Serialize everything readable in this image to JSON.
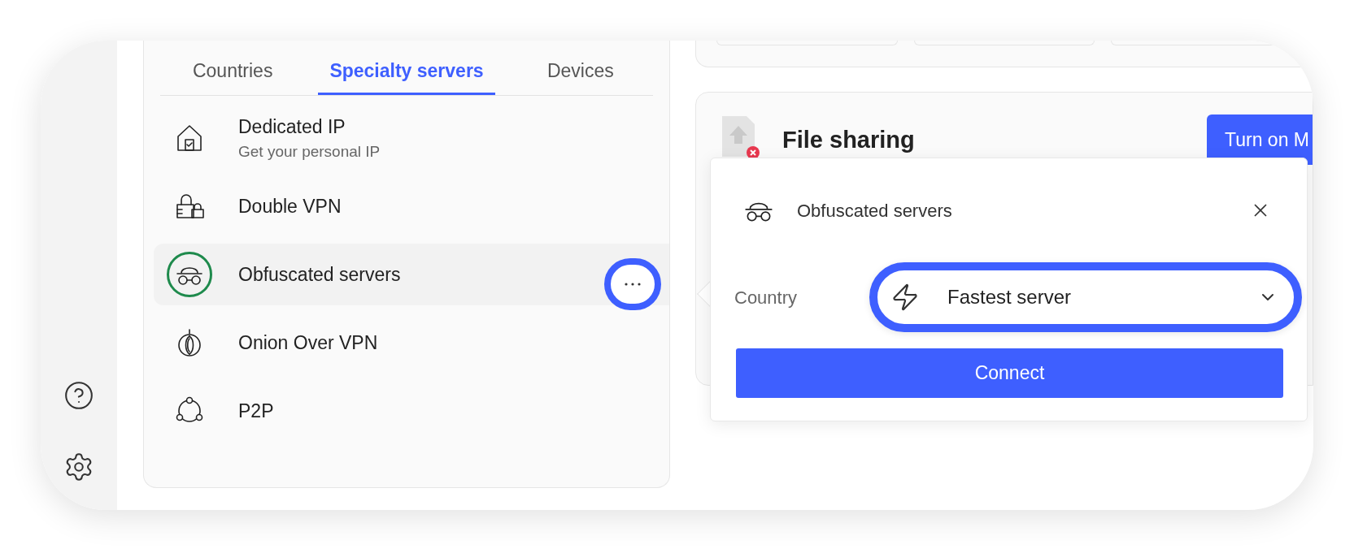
{
  "tabs": [
    {
      "label": "Countries",
      "selected": false
    },
    {
      "label": "Specialty servers",
      "selected": true
    },
    {
      "label": "Devices",
      "selected": false
    }
  ],
  "servers": [
    {
      "title": "Dedicated IP",
      "subtitle": "Get your personal IP",
      "selected": false
    },
    {
      "title": "Double VPN",
      "selected": false
    },
    {
      "title": "Obfuscated servers",
      "selected": true
    },
    {
      "title": "Onion Over VPN",
      "selected": false
    },
    {
      "title": "P2P",
      "selected": false
    }
  ],
  "file_sharing": {
    "title": "File sharing",
    "button": "Turn on M"
  },
  "popover": {
    "title": "Obfuscated servers",
    "country_label": "Country",
    "country_value": "Fastest server",
    "connect": "Connect"
  }
}
